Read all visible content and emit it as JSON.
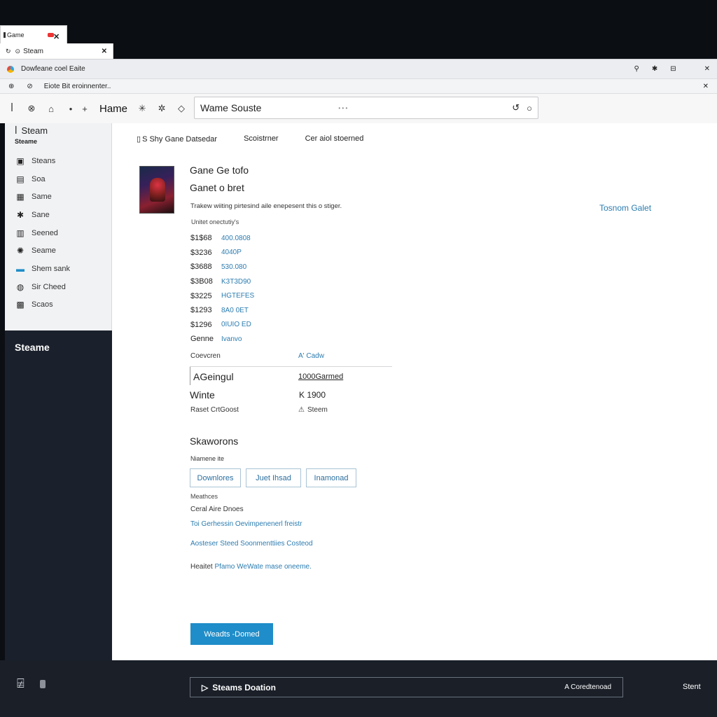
{
  "browser": {
    "tab1_label": "Game",
    "tab2_label": "Steam",
    "window_title": "Dowfeane coel Eaite",
    "bookmark_text": "Eiote  Bit eroinnenter..",
    "home_label": "Hame",
    "address_value": "Wame Souste"
  },
  "sidebar": {
    "brand": "Steam",
    "sub": "Steame",
    "items": [
      {
        "label": "Steans",
        "icon": "grid-icon"
      },
      {
        "label": "Soa",
        "icon": "library-icon"
      },
      {
        "label": "Same",
        "icon": "document-icon"
      },
      {
        "label": "Sane",
        "icon": "gear-icon"
      },
      {
        "label": "Seened",
        "icon": "list-icon"
      },
      {
        "label": "Seame",
        "icon": "person-icon"
      },
      {
        "label": "Shem sank",
        "icon": "chat-icon"
      },
      {
        "label": "Sir Cheed",
        "icon": "globe-icon"
      },
      {
        "label": "Scaos",
        "icon": "box-icon"
      }
    ],
    "dark_label": "Steame"
  },
  "main": {
    "topnav": [
      "S Shy Gane Datsedar",
      "Scoistrner",
      "Cer aiol stoerned"
    ],
    "title_line1": "Gane Ge tofo",
    "title_line2": "Ganet o bret",
    "description": "Trakew wiiting pirtesind aile enepesent this o stiger.",
    "aside_link": "Tosnom Galet",
    "section_label": "Unitet onectutiy's",
    "prices": [
      {
        "price": "$1$68",
        "value": "400.0808"
      },
      {
        "price": "$3236",
        "value": "4040P"
      },
      {
        "price": "$3688",
        "value": "530.080"
      },
      {
        "price": "$3B08",
        "value": "K3T3D90"
      },
      {
        "price": "$3225",
        "value": "HGTEFES"
      },
      {
        "price": "$1293",
        "value": "8A0 0ET"
      },
      {
        "price": "$1296",
        "value": "0IUIO ED"
      },
      {
        "price": "Genne",
        "value": "Ivanvo"
      }
    ],
    "details": {
      "head_left": "Coevcren",
      "head_right": "A' Cadw",
      "row1_left": "AGeingul",
      "row1_right": "1000Garmed",
      "row2_left": "Winte",
      "row2_right": "K 1900",
      "row3_left": "Raset CrtGoost",
      "row3_right": "Steem"
    },
    "section2_title": "Skaworons",
    "section2_sub": "Niamene ite",
    "buttons": [
      "Downlores",
      "Juet Ihsad",
      "Inamonad"
    ],
    "meta_label": "Meathces",
    "meta_sub": "Ceral Aire Dnoes",
    "link1": "Toi Gerhessin Oevimpenenerl freistr",
    "link2": "Aosteser Steed   Soonmenttiies Costeod",
    "link3_prefix": "Heaitet",
    "link3_link": "Pfamo WeWate mase oneeme.",
    "cta_label": "Weadts -Domed"
  },
  "footer": {
    "bar_left": "Steams Doation",
    "bar_right": "A Coredtenoad",
    "right_label": "Stent"
  }
}
